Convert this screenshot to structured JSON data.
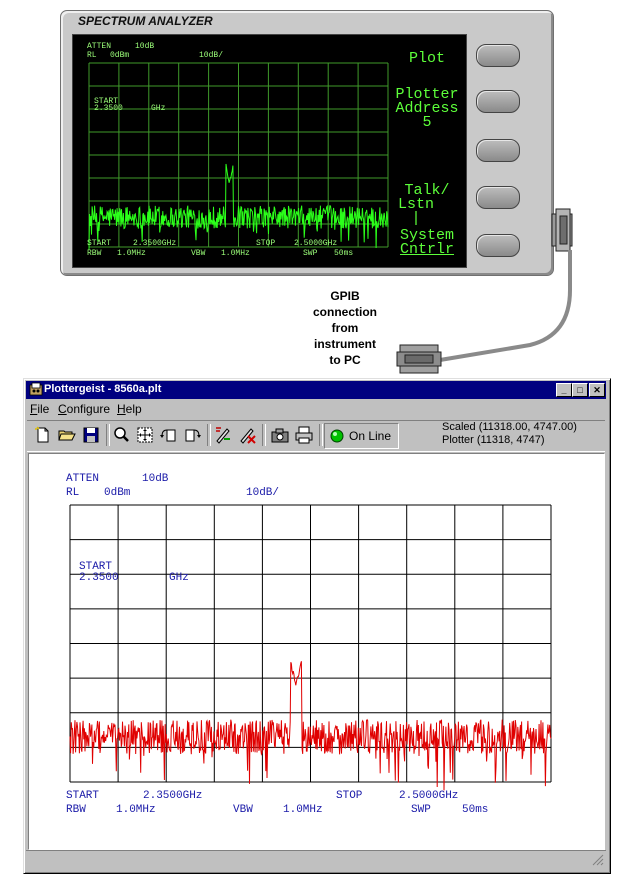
{
  "instrument": {
    "title": "SPECTRUM ANALYZER",
    "display": {
      "atten_label": "ATTEN",
      "atten_value": "10dB",
      "rl_label": "RL",
      "rl_value": "0dBm",
      "scale": "10dB/",
      "marker_start_label": "START",
      "marker_start_value": "2.3500",
      "marker_start_unit": "GHz",
      "start_label": "START",
      "start_value": "2.3500GHz",
      "stop_label": "STOP",
      "stop_value": "2.5000GHz",
      "rbw_label": "RBW",
      "rbw_value": "1.0MHz",
      "vbw_label": "VBW",
      "vbw_value": "1.0MHz",
      "swp_label": "SWP",
      "swp_value": "50ms"
    },
    "softkeys": {
      "key1": "Plot",
      "key2_line1": "Plotter",
      "key2_line2": "Address",
      "key2_line3": "5",
      "key4_line1": "Talk/",
      "key4_line2": "Lstn",
      "key4_line3": "|",
      "key5_line1": "System",
      "key5_line2": "Cntrlr"
    },
    "trace_color": "#2bff1a"
  },
  "caption": {
    "line1": "GPIB",
    "line2": "connection",
    "line3": "from",
    "line4": "instrument",
    "line5": "to PC"
  },
  "window": {
    "title": "Plottergeist - 8560a.plt",
    "controls": {
      "minimize": "_",
      "maximize": "□",
      "close": "✕"
    },
    "menu": [
      {
        "label": "File",
        "accel": "F",
        "rest": "ile"
      },
      {
        "label": "Configure",
        "accel": "C",
        "rest": "onfigure"
      },
      {
        "label": "Help",
        "accel": "H",
        "rest": "elp"
      }
    ],
    "toolbar": {
      "icons": [
        "new-file-icon",
        "open-folder-icon",
        "save-disk-icon",
        "zoom-icon",
        "fit-to-window-icon",
        "rotate-left-icon",
        "rotate-right-icon",
        "pen-settings-icon",
        "pen-delete-icon",
        "camera-icon",
        "printer-icon"
      ],
      "online_label": "On Line",
      "online_color": "#00c000"
    },
    "coords": {
      "scaled": "Scaled (11318.00, 4747.00)",
      "plotter": "Plotter (11318, 4747)"
    },
    "plot_trace_color": "#e00000",
    "plot_text_color": "#1a1aa8"
  },
  "spectrum_trace": {
    "noise_floor_db": -67,
    "peak_frequency_ghz": 2.4205,
    "peak_db": -52
  }
}
